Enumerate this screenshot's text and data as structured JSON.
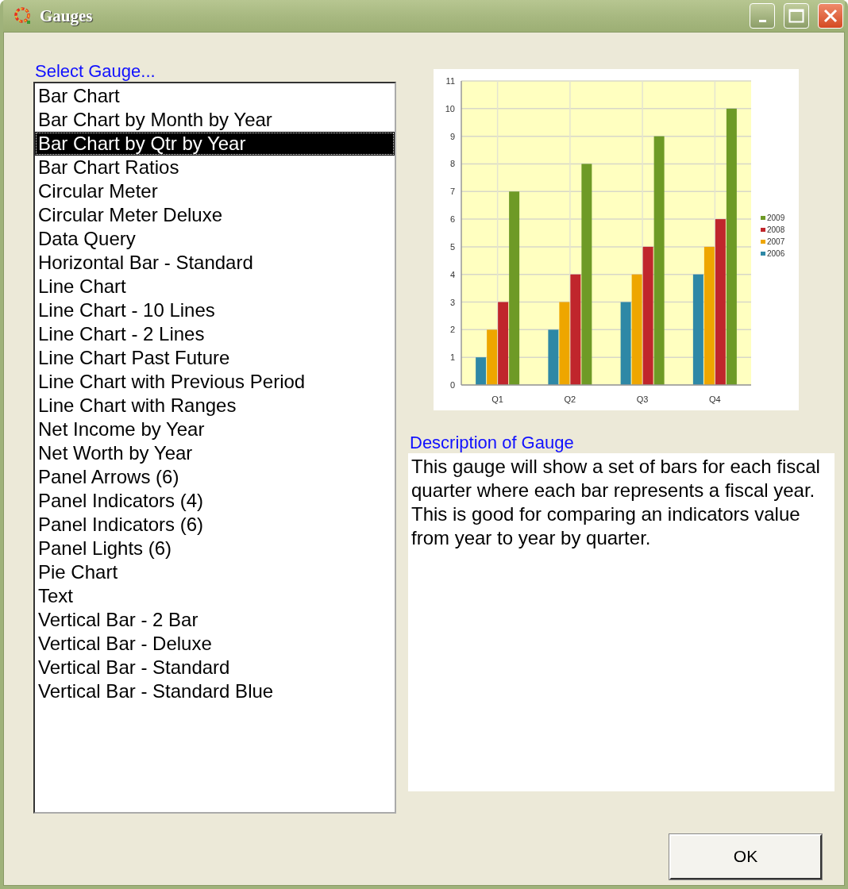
{
  "window": {
    "title": "Gauges"
  },
  "gauge_list": {
    "label": "Select Gauge...",
    "items": [
      {
        "label": "Bar Chart",
        "selected": false
      },
      {
        "label": "Bar Chart by Month by Year",
        "selected": false
      },
      {
        "label": "Bar Chart by Qtr by Year",
        "selected": true
      },
      {
        "label": "Bar Chart Ratios",
        "selected": false
      },
      {
        "label": "Circular Meter",
        "selected": false
      },
      {
        "label": "Circular Meter Deluxe",
        "selected": false
      },
      {
        "label": "Data Query",
        "selected": false
      },
      {
        "label": "Horizontal Bar - Standard",
        "selected": false
      },
      {
        "label": "Line Chart",
        "selected": false
      },
      {
        "label": "Line Chart - 10 Lines",
        "selected": false
      },
      {
        "label": "Line Chart - 2 Lines",
        "selected": false
      },
      {
        "label": "Line Chart Past Future",
        "selected": false
      },
      {
        "label": "Line Chart with Previous Period",
        "selected": false
      },
      {
        "label": "Line Chart with Ranges",
        "selected": false
      },
      {
        "label": "Net Income by Year",
        "selected": false
      },
      {
        "label": "Net Worth by Year",
        "selected": false
      },
      {
        "label": "Panel Arrows (6)",
        "selected": false
      },
      {
        "label": "Panel Indicators (4)",
        "selected": false
      },
      {
        "label": "Panel Indicators (6)",
        "selected": false
      },
      {
        "label": "Panel Lights (6)",
        "selected": false
      },
      {
        "label": "Pie Chart",
        "selected": false
      },
      {
        "label": "Text",
        "selected": false
      },
      {
        "label": "Vertical Bar - 2 Bar",
        "selected": false
      },
      {
        "label": "Vertical Bar - Deluxe",
        "selected": false
      },
      {
        "label": "Vertical Bar - Standard",
        "selected": false
      },
      {
        "label": "Vertical Bar - Standard Blue",
        "selected": false
      }
    ]
  },
  "preview": {
    "chart_data": {
      "type": "bar",
      "grid": true,
      "legend": true,
      "categories": [
        "Q1",
        "Q2",
        "Q3",
        "Q4"
      ],
      "ylim": [
        0,
        11
      ],
      "yticks": [
        0,
        1,
        2,
        3,
        4,
        5,
        6,
        7,
        8,
        9,
        10,
        11
      ],
      "series": [
        {
          "name": "2006",
          "color": "#2e88a6",
          "values": [
            1,
            2,
            3,
            4
          ]
        },
        {
          "name": "2007",
          "color": "#eea600",
          "values": [
            2,
            3,
            4,
            5
          ]
        },
        {
          "name": "2008",
          "color": "#c0262c",
          "values": [
            3,
            4,
            5,
            6
          ]
        },
        {
          "name": "2009",
          "color": "#6e9a26",
          "values": [
            7,
            8,
            9,
            10
          ]
        }
      ]
    }
  },
  "description": {
    "label": "Description of Gauge",
    "text": "This gauge will show a set of bars for each fiscal quarter where each bar represents a fiscal year.   This is good for comparing an indicators value from year to year by quarter."
  },
  "buttons": [
    {
      "label": "OK"
    }
  ]
}
